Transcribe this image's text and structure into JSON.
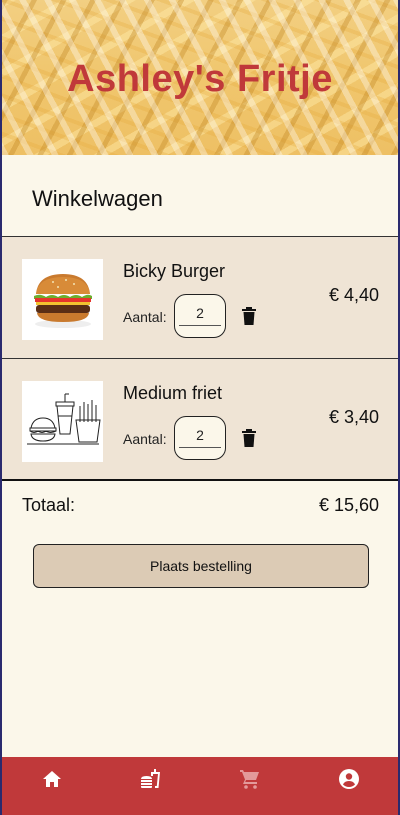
{
  "header": {
    "title": "Ashley's Fritje"
  },
  "cart": {
    "title": "Winkelwagen",
    "items": [
      {
        "name": "Bicky Burger",
        "quantity_label": "Aantal:",
        "quantity": "2",
        "price": "€ 4,40",
        "image_icon": "burger-photo"
      },
      {
        "name": "Medium friet",
        "quantity_label": "Aantal:",
        "quantity": "2",
        "price": "€ 3,40",
        "image_icon": "burger-fries-drink-outline"
      }
    ],
    "total_label": "Totaal:",
    "total_value": "€ 15,60",
    "order_button": "Plaats bestelling"
  },
  "nav": {
    "items": [
      {
        "icon": "home-icon",
        "active": true
      },
      {
        "icon": "fastfood-icon",
        "active": true
      },
      {
        "icon": "cart-icon",
        "active": false
      },
      {
        "icon": "account-icon",
        "active": true
      }
    ]
  },
  "colors": {
    "brand": "#c0393a",
    "background": "#fbf7ea",
    "item_background": "#efe4d5",
    "button_background": "#dccbb5"
  }
}
